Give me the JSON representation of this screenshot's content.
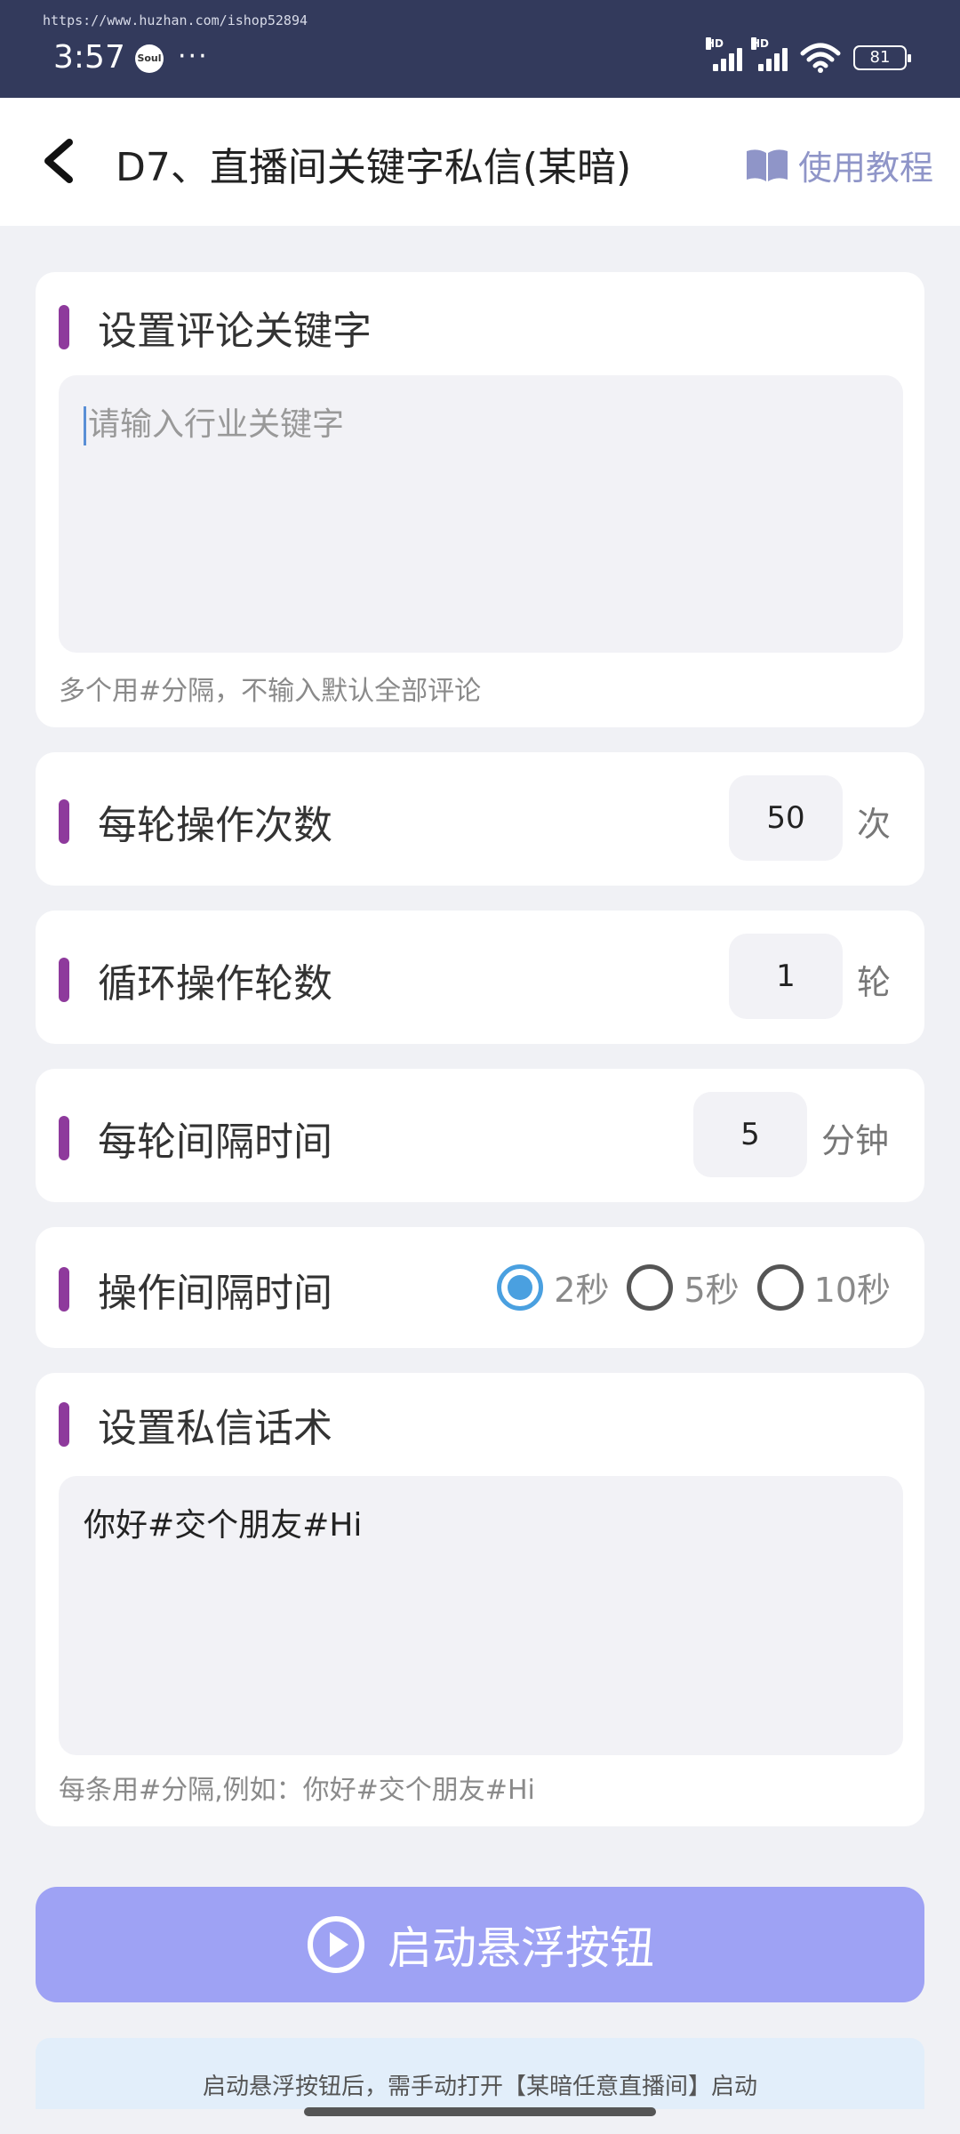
{
  "status_bar": {
    "watermark": "https://www.huzhan.com/ishop52894",
    "time": "3:57",
    "app_icon_text": "Soul",
    "dots": "···",
    "hd_label": "HD",
    "battery": "81"
  },
  "header": {
    "title": "D7、直播间关键字私信(某暗)",
    "tutorial_label": "使用教程"
  },
  "keyword_card": {
    "title": "设置评论关键字",
    "placeholder": "请输入行业关键字",
    "hint": "多个用#分隔，不输入默认全部评论"
  },
  "ops_per_round": {
    "title": "每轮操作次数",
    "value": "50",
    "unit": "次"
  },
  "loop_rounds": {
    "title": "循环操作轮数",
    "value": "1",
    "unit": "轮"
  },
  "round_interval": {
    "title": "每轮间隔时间",
    "value": "5",
    "unit": "分钟"
  },
  "op_interval": {
    "title": "操作间隔时间",
    "options": [
      {
        "label": "2秒",
        "checked": true
      },
      {
        "label": "5秒",
        "checked": false
      },
      {
        "label": "10秒",
        "checked": false
      }
    ]
  },
  "message_card": {
    "title": "设置私信话术",
    "value": "你好#交个朋友#Hi",
    "hint": "每条用#分隔,例如：你好#交个朋友#Hi"
  },
  "start_button": {
    "label": "启动悬浮按钮"
  },
  "notice": "启动悬浮按钮后，需手动打开【某暗任意直播间】启动",
  "colors": {
    "accent_bar": "#8e3a9c",
    "button": "#9ea2f4",
    "radio_checked": "#4aa0e0",
    "status_bar": "#333a5c"
  }
}
